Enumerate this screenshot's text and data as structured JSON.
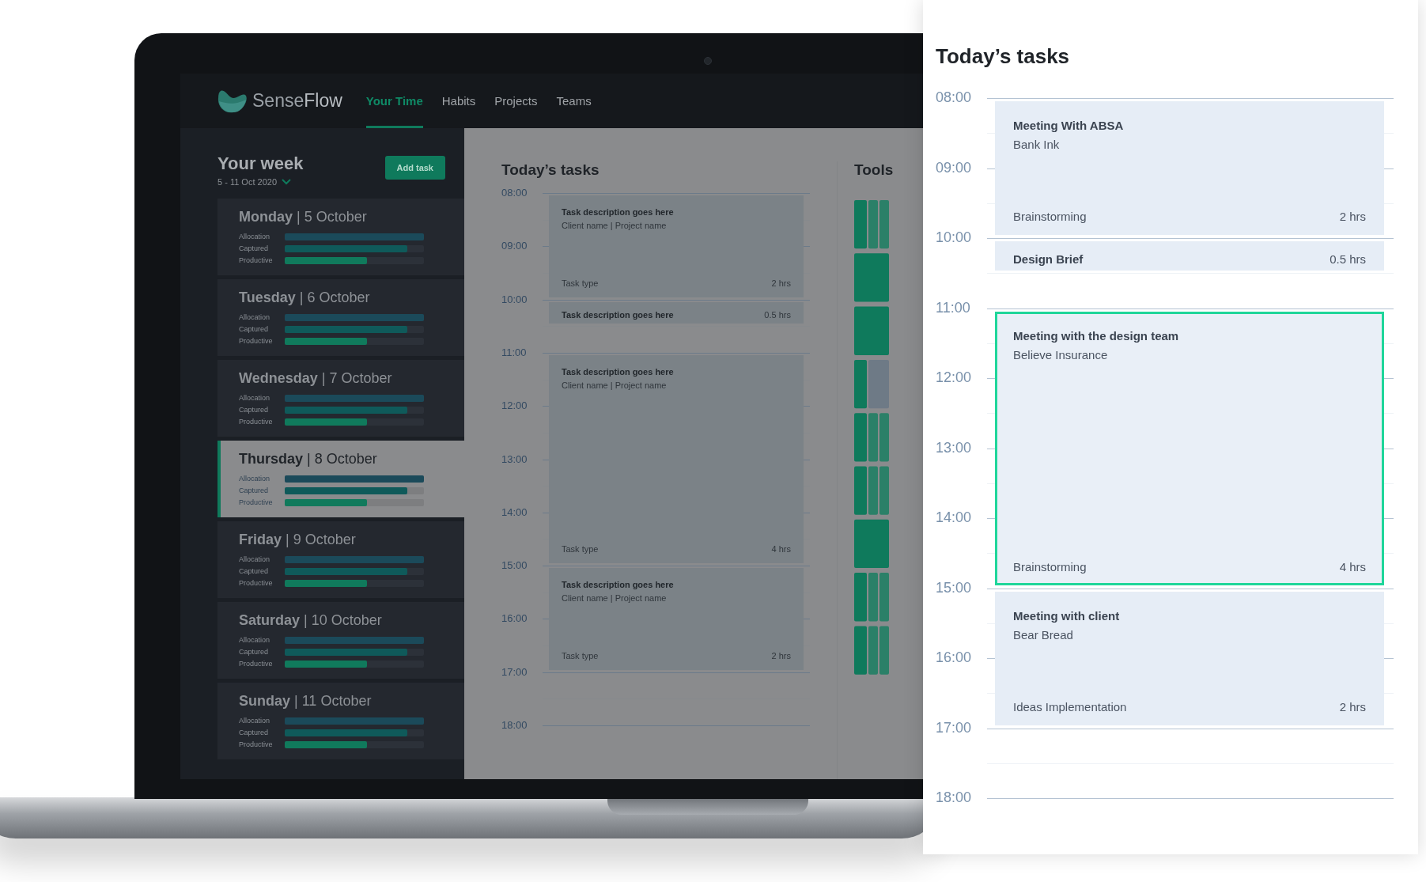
{
  "laptop": {
    "brand": "Sense**Flow**",
    "nav": [
      {
        "label": "Your Time",
        "selected": true
      },
      {
        "label": "Habits",
        "selected": false
      },
      {
        "label": "Projects",
        "selected": false
      },
      {
        "label": "Teams",
        "selected": false
      }
    ],
    "week": {
      "title": "Your week",
      "range": "5 - 11 Oct 2020",
      "add_button": "Add task"
    },
    "days": [
      {
        "label": "**Monday** | 5 October",
        "selected": false,
        "metrics": [
          {
            "label": "Allocation",
            "level": 1,
            "color": "#1b4a5a"
          },
          {
            "label": "Captured",
            "level": 0.88,
            "color": "#0f5a5a"
          },
          {
            "label": "Productive",
            "level": 0.59,
            "color": "#107a5c"
          }
        ]
      },
      {
        "label": "**Tuesday** | 6 October",
        "selected": false,
        "metrics": [
          {
            "label": "Allocation",
            "level": 1,
            "color": "#1b4a5a"
          },
          {
            "label": "Captured",
            "level": 0.88,
            "color": "#0f5a5a"
          },
          {
            "label": "Productive",
            "level": 0.59,
            "color": "#107a5c"
          }
        ]
      },
      {
        "label": "**Wednesday** | 7 October",
        "selected": false,
        "metrics": [
          {
            "label": "Allocation",
            "level": 1,
            "color": "#1b4a5a"
          },
          {
            "label": "Captured",
            "level": 0.88,
            "color": "#0f5a5a"
          },
          {
            "label": "Productive",
            "level": 0.59,
            "color": "#107a5c"
          }
        ]
      },
      {
        "label": "**Thursday** | 8 October",
        "selected": true,
        "metrics": [
          {
            "label": "Allocation",
            "level": 1,
            "color": "#1b4a5a"
          },
          {
            "label": "Captured",
            "level": 0.88,
            "color": "#0f5a5a"
          },
          {
            "label": "Productive",
            "level": 0.59,
            "color": "#107a5c"
          }
        ]
      },
      {
        "label": "**Friday** | 9 October",
        "selected": false,
        "metrics": [
          {
            "label": "Allocation",
            "level": 1,
            "color": "#1b4a5a"
          },
          {
            "label": "Captured",
            "level": 0.88,
            "color": "#0f5a5a"
          },
          {
            "label": "Productive",
            "level": 0.59,
            "color": "#107a5c"
          }
        ]
      },
      {
        "label": "**Saturday** | 10 October",
        "selected": false,
        "metrics": [
          {
            "label": "Allocation",
            "level": 1,
            "color": "#1b4a5a"
          },
          {
            "label": "Captured",
            "level": 0.88,
            "color": "#0f5a5a"
          },
          {
            "label": "Productive",
            "level": 0.59,
            "color": "#107a5c"
          }
        ]
      },
      {
        "label": "**Sunday** | 11 October",
        "selected": false,
        "metrics": [
          {
            "label": "Allocation",
            "level": 1,
            "color": "#1b4a5a"
          },
          {
            "label": "Captured",
            "level": 0.88,
            "color": "#0f5a5a"
          },
          {
            "label": "Productive",
            "level": 0.59,
            "color": "#107a5c"
          }
        ]
      }
    ],
    "tasks_title": "Today’s tasks",
    "hours": [
      {
        "time": "08:00",
        "task": {
          "kind": "full",
          "title": "Task description goes here",
          "subtitle": "Client name | Project name",
          "type": "Task type",
          "duration": "2 hrs"
        }
      },
      {
        "time": "09:00"
      },
      {
        "time": "10:00",
        "task": {
          "kind": "compact",
          "title": "Task description goes here",
          "duration": "0.5 hrs"
        }
      },
      {
        "time": "11:00",
        "task": {
          "kind": "full",
          "title": "Task description goes here",
          "subtitle": "Client name | Project name",
          "type": "Task type",
          "duration": "4 hrs"
        }
      },
      {
        "time": "12:00"
      },
      {
        "time": "13:00"
      },
      {
        "time": "14:00"
      },
      {
        "time": "15:00",
        "task": {
          "kind": "full",
          "title": "Task description goes here",
          "subtitle": "Client name | Project name",
          "type": "Task type",
          "duration": "2 hrs"
        }
      },
      {
        "time": "16:00"
      },
      {
        "time": "17:00"
      },
      {
        "time": "18:00"
      }
    ],
    "tools_title": "Tools"
  },
  "panel": {
    "title": "Today’s tasks",
    "hours": [
      {
        "time": "08:00",
        "task": {
          "kind": "full",
          "title": "Meeting With ABSA",
          "subtitle": "Bank Ink",
          "type": "Brainstorming",
          "duration": "2 hrs",
          "selected": false
        }
      },
      {
        "time": "09:00"
      },
      {
        "time": "10:00",
        "task": {
          "kind": "compact",
          "title": "Design Brief",
          "duration": "0.5 hrs",
          "selected": false
        }
      },
      {
        "time": "11:00",
        "task": {
          "kind": "full",
          "title": "Meeting with the design team",
          "subtitle": "Believe Insurance",
          "type": "Brainstorming",
          "duration": "4 hrs",
          "selected": true
        }
      },
      {
        "time": "12:00"
      },
      {
        "time": "13:00"
      },
      {
        "time": "14:00"
      },
      {
        "time": "15:00",
        "task": {
          "kind": "full",
          "title": "Meeting with client",
          "subtitle": "Bear Bread",
          "type": "Ideas Implementation",
          "duration": "2 hrs",
          "selected": false
        }
      },
      {
        "time": "16:00"
      },
      {
        "time": "17:00"
      },
      {
        "time": "18:00"
      }
    ]
  }
}
